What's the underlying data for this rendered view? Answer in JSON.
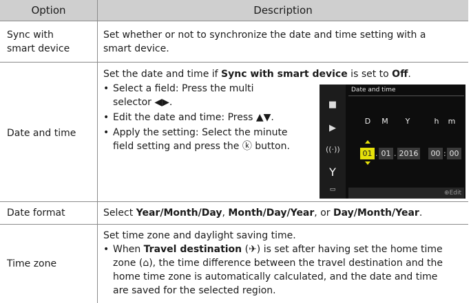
{
  "header": {
    "option": "Option",
    "description": "Description"
  },
  "rows": [
    {
      "option_line1": "Sync with",
      "option_line2": "smart device",
      "desc_line1": "Set whether or not to synchronize the date and time setting with a",
      "desc_line2": "smart device."
    },
    {
      "option": "Date and time",
      "intro_pre": "Set the date and time if ",
      "intro_b1": "Sync with smart device",
      "intro_mid": " is set to ",
      "intro_b2": "Off",
      "intro_end": ".",
      "bullet1_l1": "Select a field: Press the multi",
      "bullet1_l2": "selector ◀▶.",
      "bullet2": "Edit the date and time: Press ▲▼.",
      "bullet3_l1": "Apply the setting: Select the minute",
      "bullet3_l2": "field setting and press the ⓚ button."
    },
    {
      "option": "Date format",
      "pre": "Select ",
      "b1": "Year/Month/Day",
      "sep1": ", ",
      "b2": "Month/Day/Year",
      "sep2": ", or ",
      "b3": "Day/Month/Year",
      "end": "."
    },
    {
      "option": "Time zone",
      "intro": "Set time zone and daylight saving time.",
      "b_pre": "When ",
      "b_bold": "Travel destination",
      "b_l1_rest": " (✈) is set after having set the home time",
      "b_l2": "zone (⌂), the time difference between the travel destination and the",
      "b_l3": "home time zone is automatically calculated, and the date and time",
      "b_l4": "are saved for the selected region."
    }
  ],
  "camera_screen": {
    "title": "Date and time",
    "labels": {
      "d": "D",
      "m": "M",
      "y": "Y",
      "h": "h",
      "min": "m"
    },
    "values": {
      "day": "01",
      "month": "01",
      "year": "2016",
      "hour": "00",
      "minute": "00"
    },
    "edit_label": "Edit",
    "highlight_color": "#e6e10a",
    "icons": [
      "camera-icon",
      "movie-camera-icon",
      "wireless-icon",
      "wrench-icon",
      "battery-icon"
    ]
  }
}
